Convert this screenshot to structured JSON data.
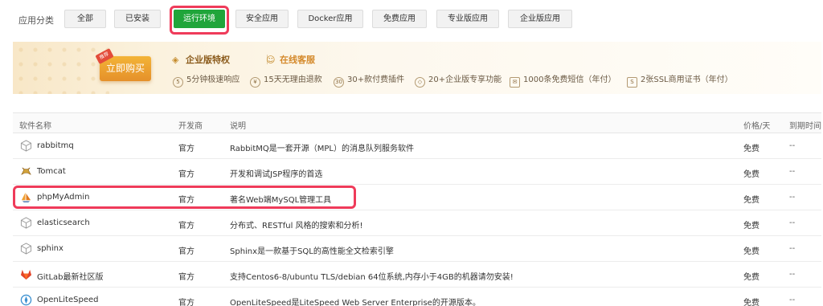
{
  "categories": {
    "label": "应用分类",
    "items": [
      "全部",
      "已安装",
      "运行环境",
      "安全应用",
      "Docker应用",
      "免费应用",
      "专业版应用",
      "企业版应用"
    ],
    "active": "运行环境"
  },
  "promo": {
    "buy_label": "立即购买",
    "tag": "推荐",
    "enterprise_title": "企业版特权",
    "service_title": "在线客服",
    "features": [
      "5分钟极速响应",
      "15天无理由退款",
      "30+款付费插件",
      "20+企业版专享功能",
      "1000条免费短信（年付）",
      "2张SSL商用证书（年付）"
    ],
    "accent_color": "#e5902a"
  },
  "table": {
    "columns": [
      "软件名称",
      "开发商",
      "说明",
      "价格/天",
      "到期时间"
    ],
    "rows": [
      {
        "name": "rabbitmq",
        "dev": "官方",
        "desc": "RabbitMQ是一套开源（MPL）的消息队列服务软件",
        "price": "免费",
        "expire": "--",
        "icon": "cube-icon"
      },
      {
        "name": "Tomcat",
        "dev": "官方",
        "desc": "开发和调试JSP程序的首选",
        "price": "免费",
        "expire": "--",
        "icon": "tomcat-icon"
      },
      {
        "name": "phpMyAdmin",
        "dev": "官方",
        "desc": "著名Web端MySQL管理工具",
        "price": "免费",
        "expire": "--",
        "icon": "sailboat-icon"
      },
      {
        "name": "elasticsearch",
        "dev": "官方",
        "desc": "分布式、RESTful 风格的搜索和分析!",
        "price": "免费",
        "expire": "--",
        "icon": "cube-icon"
      },
      {
        "name": "sphinx",
        "dev": "官方",
        "desc": "Sphinx是一款基于SQL的高性能全文检索引擎",
        "price": "免费",
        "expire": "--",
        "icon": "cube-icon"
      },
      {
        "name": "GitLab最新社区版",
        "dev": "官方",
        "desc": "支持Centos6-8/ubuntu TLS/debian 64位系统,内存小于4GB的机器请勿安装!",
        "price": "免费",
        "expire": "--",
        "icon": "gitlab-icon"
      },
      {
        "name": "OpenLiteSpeed",
        "dev": "官方",
        "desc": "OpenLiteSpeed是LiteSpeed Web Server Enterprise的开源版本。",
        "price": "免费",
        "expire": "--",
        "icon": "litespeed-icon"
      }
    ]
  }
}
